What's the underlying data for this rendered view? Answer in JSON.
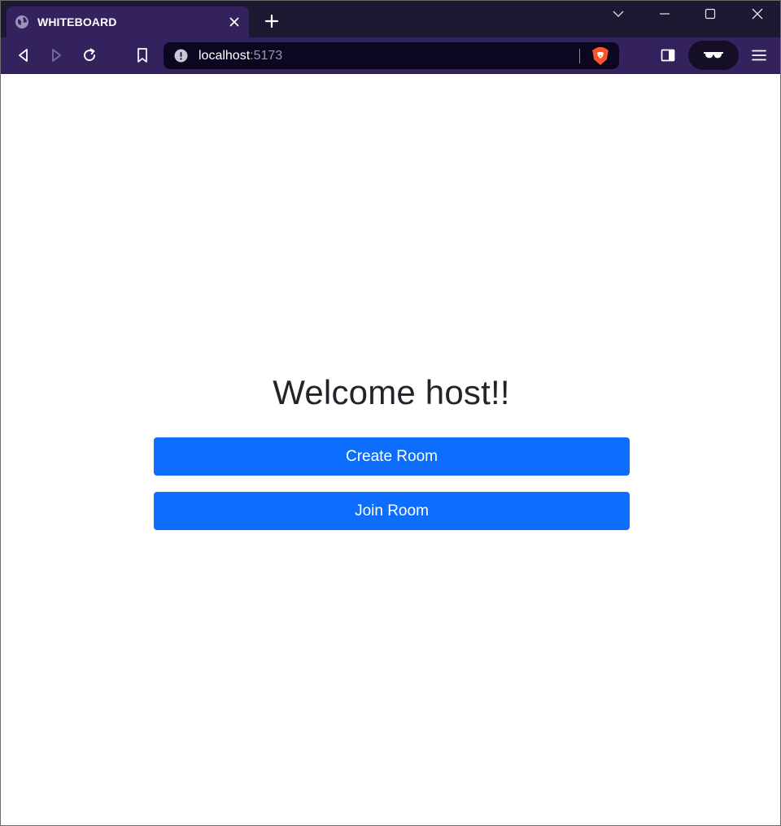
{
  "browser": {
    "tab": {
      "title": "WHITEBOARD",
      "icon": "globe-icon"
    },
    "address": {
      "host": "localhost",
      "port": ":5173"
    },
    "colors": {
      "tabstrip": "#1c1a33",
      "toolbar": "#33225e",
      "urlbar": "#0b0720"
    }
  },
  "page": {
    "heading": "Welcome host!!",
    "buttons": {
      "create_room": "Create Room",
      "join_room": "Join Room"
    },
    "colors": {
      "primary": "#0d6efd",
      "heading": "#212529"
    }
  }
}
